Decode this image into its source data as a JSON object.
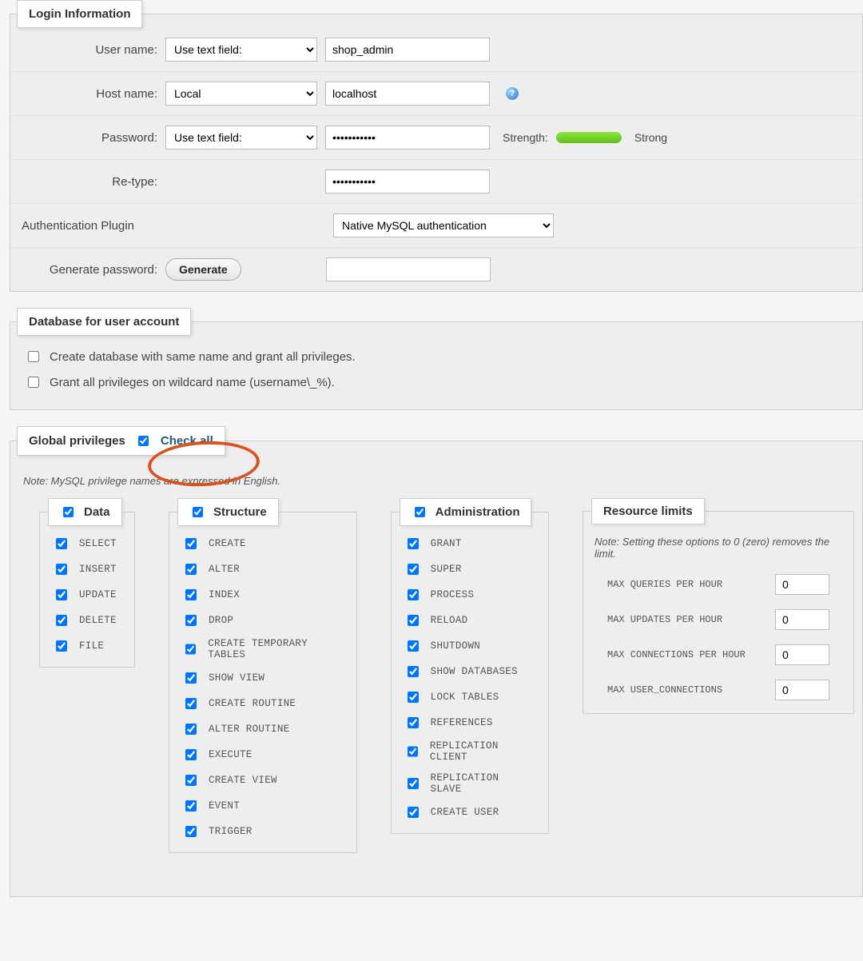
{
  "login": {
    "legend": "Login Information",
    "labels": {
      "username": "User name:",
      "hostname": "Host name:",
      "password": "Password:",
      "retype": "Re-type:",
      "authplugin": "Authentication Plugin",
      "generate": "Generate password:"
    },
    "username_mode": "Use text field:",
    "username_value": "shop_admin",
    "hostname_mode": "Local",
    "hostname_value": "localhost",
    "password_mode": "Use text field:",
    "password_value": "•••••••••••",
    "retype_value": "•••••••••••",
    "strength_label": "Strength:",
    "strength_text": "Strong",
    "authplugin_value": "Native MySQL authentication",
    "generate_btn": "Generate",
    "generate_value": ""
  },
  "db": {
    "legend": "Database for user account",
    "opt1": "Create database with same name and grant all privileges.",
    "opt2": "Grant all privileges on wildcard name (username\\_%)."
  },
  "global": {
    "legend": "Global privileges",
    "checkall": "Check all",
    "note": "Note: MySQL privilege names are expressed in English.",
    "data_title": "Data",
    "data_items": [
      "SELECT",
      "INSERT",
      "UPDATE",
      "DELETE",
      "FILE"
    ],
    "structure_title": "Structure",
    "structure_items": [
      "CREATE",
      "ALTER",
      "INDEX",
      "DROP",
      "CREATE TEMPORARY TABLES",
      "SHOW VIEW",
      "CREATE ROUTINE",
      "ALTER ROUTINE",
      "EXECUTE",
      "CREATE VIEW",
      "EVENT",
      "TRIGGER"
    ],
    "admin_title": "Administration",
    "admin_items": [
      "GRANT",
      "SUPER",
      "PROCESS",
      "RELOAD",
      "SHUTDOWN",
      "SHOW DATABASES",
      "LOCK TABLES",
      "REFERENCES",
      "REPLICATION CLIENT",
      "REPLICATION SLAVE",
      "CREATE USER"
    ],
    "res_title": "Resource limits",
    "res_note": "Note: Setting these options to 0 (zero) removes the limit.",
    "res_items": [
      {
        "label": "MAX QUERIES PER HOUR",
        "value": "0"
      },
      {
        "label": "MAX UPDATES PER HOUR",
        "value": "0"
      },
      {
        "label": "MAX CONNECTIONS PER HOUR",
        "value": "0"
      },
      {
        "label": "MAX USER_CONNECTIONS",
        "value": "0"
      }
    ]
  }
}
